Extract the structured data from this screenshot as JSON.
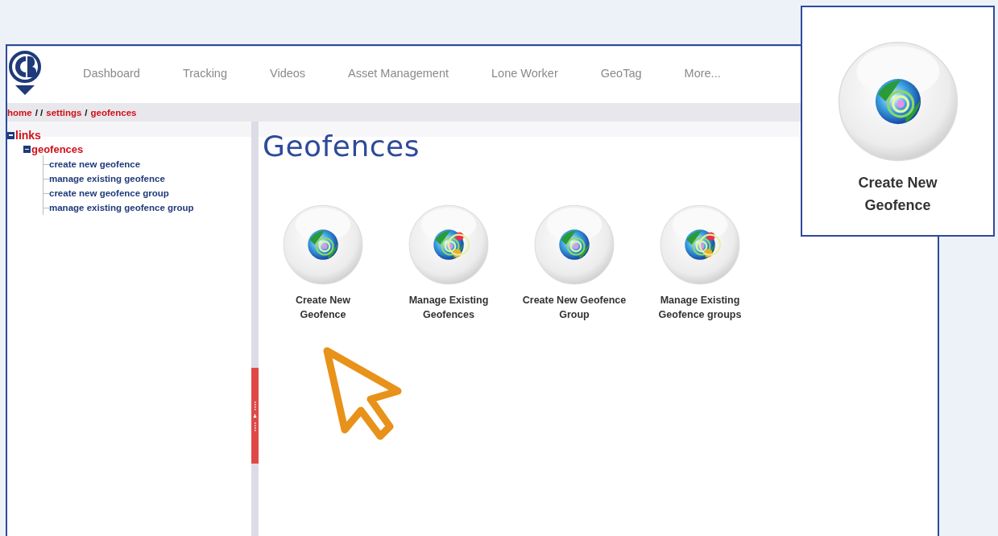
{
  "nav": {
    "items": [
      {
        "label": "Dashboard"
      },
      {
        "label": "Tracking"
      },
      {
        "label": "Videos"
      },
      {
        "label": "Asset Management"
      },
      {
        "label": "Lone Worker"
      },
      {
        "label": "GeoTag"
      },
      {
        "label": "More..."
      }
    ]
  },
  "breadcrumb": [
    {
      "kind": "link",
      "text": "home"
    },
    {
      "kind": "separator",
      "text": "/ /"
    },
    {
      "kind": "link",
      "text": "settings"
    },
    {
      "kind": "separator",
      "text": "/"
    },
    {
      "kind": "link",
      "text": "geofences"
    }
  ],
  "tree": [
    {
      "label": "links",
      "expanded": true,
      "children": [
        {
          "label": "geofences",
          "expanded": true,
          "children": [
            {
              "label": "create new geofence"
            },
            {
              "label": "manage existing geofence"
            },
            {
              "label": "create new geofence group"
            },
            {
              "label": "manage existing geofence group"
            }
          ]
        }
      ]
    }
  ],
  "page_title": "Geofences",
  "tiles": [
    {
      "label": "Create New Geofence",
      "kind": "create"
    },
    {
      "label": "Manage Existing Geofences",
      "kind": "manage"
    },
    {
      "label": "Create New Geofence Group",
      "kind": "create"
    },
    {
      "label": "Manage Existing Geofence groups",
      "kind": "manage"
    }
  ],
  "callout": {
    "label": "Create New Geofence",
    "kind": "create"
  }
}
